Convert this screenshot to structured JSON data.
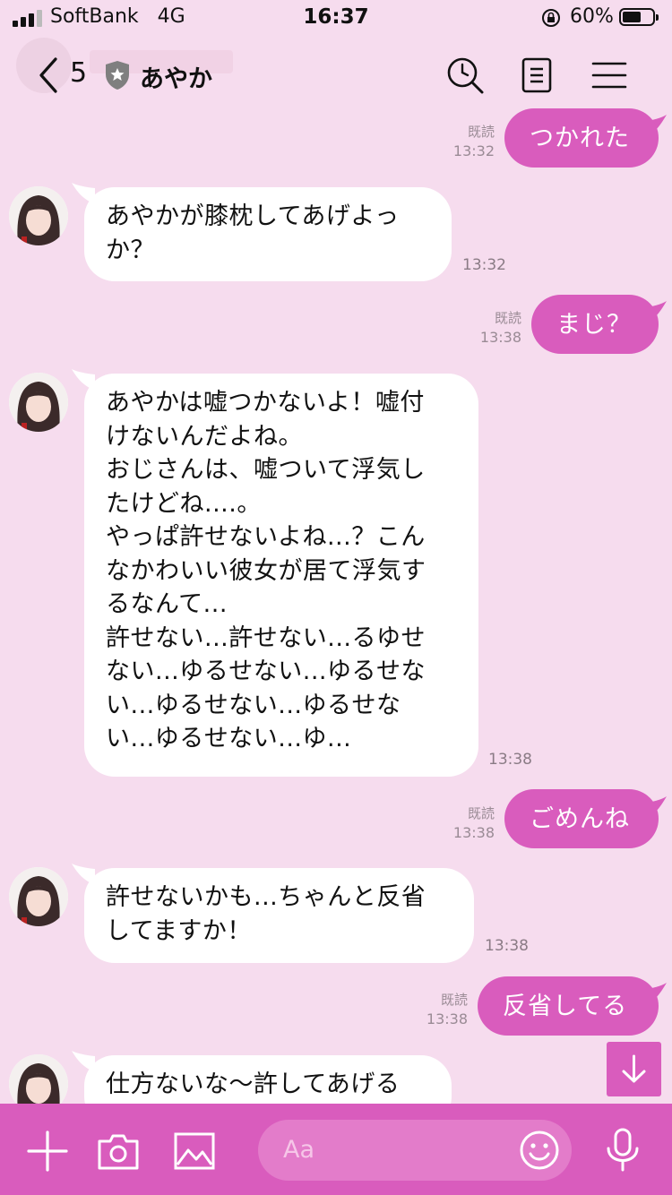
{
  "status_bar": {
    "carrier": "SoftBank",
    "network": "4G",
    "time": "16:37",
    "battery": "60%"
  },
  "header": {
    "back_count": "5",
    "chat_name": "あやか",
    "icons": [
      "back-chevron-icon",
      "shield-star-icon",
      "search-clock-icon",
      "notes-icon",
      "menu-icon"
    ]
  },
  "messages": [
    {
      "side": "out",
      "text": "つかれた",
      "read": "既読",
      "time": "13:32"
    },
    {
      "side": "in",
      "text": "あやかが膝枕してあげよっ\nか？",
      "time": "13:32"
    },
    {
      "side": "out",
      "text": "まじ？",
      "read": "既読",
      "time": "13:38"
    },
    {
      "side": "in",
      "text": "あやかは嘘つかないよ！嘘付\nけないんだよね。\nおじさんは、嘘ついて浮気し\nたけどね....。\nやっぱ許せないよね...？こん\nなかわいい彼女が居て浮気す\nるなんて...\n許せない...許せない...るゆせ\nない...ゆるせない...ゆるせな\nい...ゆるせない...ゆるせな\nい...ゆるせない...ゆ...",
      "time": "13:38"
    },
    {
      "side": "out",
      "text": "ごめんね",
      "read": "既読",
      "time": "13:38"
    },
    {
      "side": "in",
      "text": "許せないかも...ちゃんと反省\nしてますか！",
      "time": "13:38"
    },
    {
      "side": "out",
      "text": "反省してる",
      "read": "既読",
      "time": "13:38"
    },
    {
      "side": "in",
      "text": "仕方ないな〜許してあげる",
      "time": ""
    }
  ],
  "input": {
    "placeholder": "Aa"
  },
  "colors": {
    "background": "#f6dcee",
    "accent": "#d95cbd",
    "incoming_bubble": "#ffffff"
  }
}
